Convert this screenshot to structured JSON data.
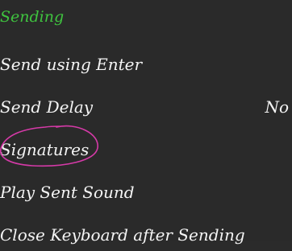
{
  "section": {
    "title": "Sending",
    "title_color": "#3fc43f"
  },
  "rows": [
    {
      "label": "Send using Enter",
      "value": ""
    },
    {
      "label": "Send Delay",
      "value": "No"
    },
    {
      "label": "Signatures",
      "value": ""
    },
    {
      "label": "Play Sent Sound",
      "value": ""
    },
    {
      "label": "Close Keyboard after Sending",
      "value": ""
    }
  ],
  "annotation": {
    "shape": "hand-drawn-ellipse",
    "color": "#d63aa8",
    "target": "Signatures"
  }
}
